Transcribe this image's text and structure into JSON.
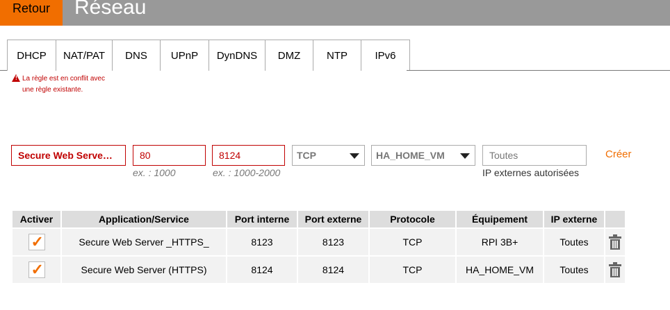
{
  "header": {
    "back_label": "Retour",
    "title": "Réseau"
  },
  "tabs": [
    {
      "label": "DHCP"
    },
    {
      "label": "NAT/PAT",
      "active": true
    },
    {
      "label": "DNS"
    },
    {
      "label": "UPnP"
    },
    {
      "label": "DynDNS"
    },
    {
      "label": "DMZ"
    },
    {
      "label": "NTP"
    },
    {
      "label": "IPv6"
    }
  ],
  "warning": {
    "text": "La règle est en conflit avec une règle existante."
  },
  "form": {
    "service_value": "Secure Web Serve…",
    "internal_port_value": "80",
    "internal_port_hint": "ex. : 1000",
    "external_port_value": "8124",
    "external_port_hint": "ex. : 1000-2000",
    "protocol_value": "TCP",
    "device_value": "HA_HOME_VM",
    "external_ip_placeholder": "Toutes",
    "external_ip_hint": "IP externes autorisées",
    "create_label": "Créer"
  },
  "table": {
    "headers": [
      "Activer",
      "Application/Service",
      "Port interne",
      "Port externe",
      "Protocole",
      "Équipement",
      "IP externe",
      ""
    ],
    "rows": [
      {
        "checked": true,
        "service": "Secure Web Server _HTTPS_",
        "internal": "8123",
        "external": "8123",
        "protocol": "TCP",
        "device": "RPI 3B+",
        "ip": "Toutes"
      },
      {
        "checked": true,
        "service": "Secure Web Server (HTTPS)",
        "internal": "8124",
        "external": "8124",
        "protocol": "TCP",
        "device": "HA_HOME_VM",
        "ip": "Toutes"
      }
    ]
  },
  "colors": {
    "accent": "#f16e00",
    "error": "#c00000",
    "header_bar": "#999999"
  }
}
